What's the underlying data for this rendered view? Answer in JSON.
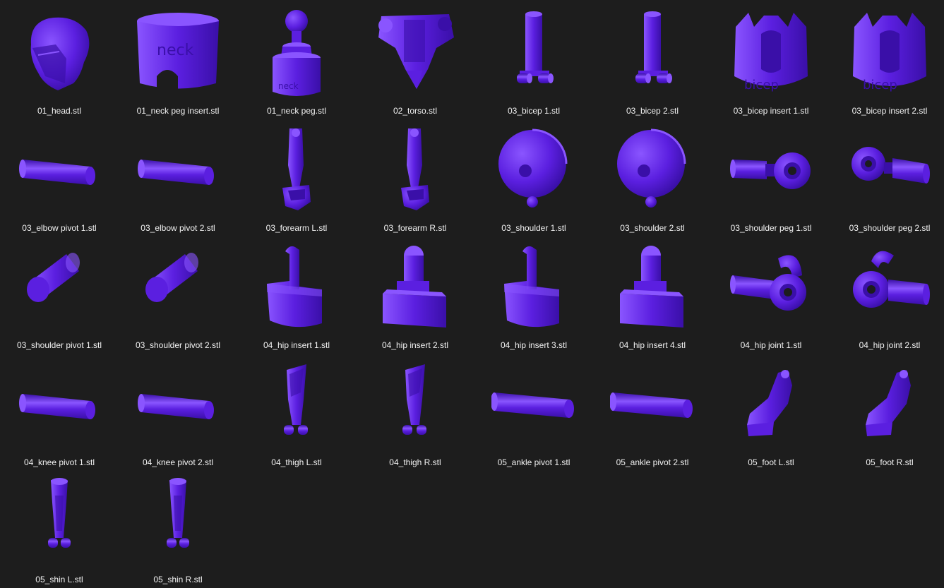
{
  "files": [
    {
      "name": "01_head.stl",
      "icon": "head-model-icon",
      "shape": "head"
    },
    {
      "name": "01_neck peg insert.stl",
      "icon": "neck-peg-insert-model-icon",
      "shape": "neckinsert"
    },
    {
      "name": "01_neck peg.stl",
      "icon": "neck-peg-model-icon",
      "shape": "neckpeg"
    },
    {
      "name": "02_torso.stl",
      "icon": "torso-model-icon",
      "shape": "torso"
    },
    {
      "name": "03_bicep 1.stl",
      "icon": "bicep-model-icon",
      "shape": "bicep"
    },
    {
      "name": "03_bicep 2.stl",
      "icon": "bicep-model-icon",
      "shape": "bicep"
    },
    {
      "name": "03_bicep insert 1.stl",
      "icon": "bicep-insert-model-icon",
      "shape": "bicepinsert"
    },
    {
      "name": "03_bicep insert 2.stl",
      "icon": "bicep-insert-model-icon",
      "shape": "bicepinsert"
    },
    {
      "name": "03_elbow pivot 1.stl",
      "icon": "pivot-rod-model-icon",
      "shape": "rod"
    },
    {
      "name": "03_elbow pivot 2.stl",
      "icon": "pivot-rod-model-icon",
      "shape": "rod"
    },
    {
      "name": "03_forearm L.stl",
      "icon": "forearm-model-icon",
      "shape": "forearm"
    },
    {
      "name": "03_forearm R.stl",
      "icon": "forearm-model-icon",
      "shape": "forearm"
    },
    {
      "name": "03_shoulder 1.stl",
      "icon": "shoulder-ball-model-icon",
      "shape": "shoulder"
    },
    {
      "name": "03_shoulder 2.stl",
      "icon": "shoulder-ball-model-icon",
      "shape": "shoulder"
    },
    {
      "name": "03_shoulder peg 1.stl",
      "icon": "shoulder-peg-model-icon",
      "shape": "shoulderpeg1"
    },
    {
      "name": "03_shoulder peg 2.stl",
      "icon": "shoulder-peg-model-icon",
      "shape": "shoulderpeg2"
    },
    {
      "name": "03_shoulder pivot 1.stl",
      "icon": "shoulder-pivot-model-icon",
      "shape": "pivotdiag"
    },
    {
      "name": "03_shoulder pivot 2.stl",
      "icon": "shoulder-pivot-model-icon",
      "shape": "pivotdiag"
    },
    {
      "name": "04_hip insert 1.stl",
      "icon": "hip-insert-model-icon",
      "shape": "hipinsert1"
    },
    {
      "name": "04_hip insert 2.stl",
      "icon": "hip-insert-model-icon",
      "shape": "hipinsert2"
    },
    {
      "name": "04_hip insert 3.stl",
      "icon": "hip-insert-model-icon",
      "shape": "hipinsert1"
    },
    {
      "name": "04_hip insert 4.stl",
      "icon": "hip-insert-model-icon",
      "shape": "hipinsert2"
    },
    {
      "name": "04_hip joint 1.stl",
      "icon": "hip-joint-model-icon",
      "shape": "hipjoint1"
    },
    {
      "name": "04_hip joint 2.stl",
      "icon": "hip-joint-model-icon",
      "shape": "hipjoint2"
    },
    {
      "name": "04_knee pivot 1.stl",
      "icon": "pivot-rod-model-icon",
      "shape": "rod"
    },
    {
      "name": "04_knee pivot 2.stl",
      "icon": "pivot-rod-model-icon",
      "shape": "rod"
    },
    {
      "name": "04_thigh L.stl",
      "icon": "thigh-model-icon",
      "shape": "thigh"
    },
    {
      "name": "04_thigh R.stl",
      "icon": "thigh-model-icon",
      "shape": "thigh"
    },
    {
      "name": "05_ankle pivot 1.stl",
      "icon": "pivot-rod-model-icon",
      "shape": "rodlong"
    },
    {
      "name": "05_ankle pivot 2.stl",
      "icon": "pivot-rod-model-icon",
      "shape": "rodlong"
    },
    {
      "name": "05_foot L.stl",
      "icon": "foot-model-icon",
      "shape": "foot"
    },
    {
      "name": "05_foot R.stl",
      "icon": "foot-model-icon",
      "shape": "foot"
    },
    {
      "name": "05_shin L.stl",
      "icon": "shin-model-icon",
      "shape": "shin"
    },
    {
      "name": "05_shin R.stl",
      "icon": "shin-model-icon",
      "shape": "shin"
    }
  ],
  "colors": {
    "background": "#1d1d1d",
    "model_base": "#5b1fe0",
    "model_light": "#8a55ff",
    "model_dark": "#3a0fa8",
    "label": "#f2f2f2"
  }
}
